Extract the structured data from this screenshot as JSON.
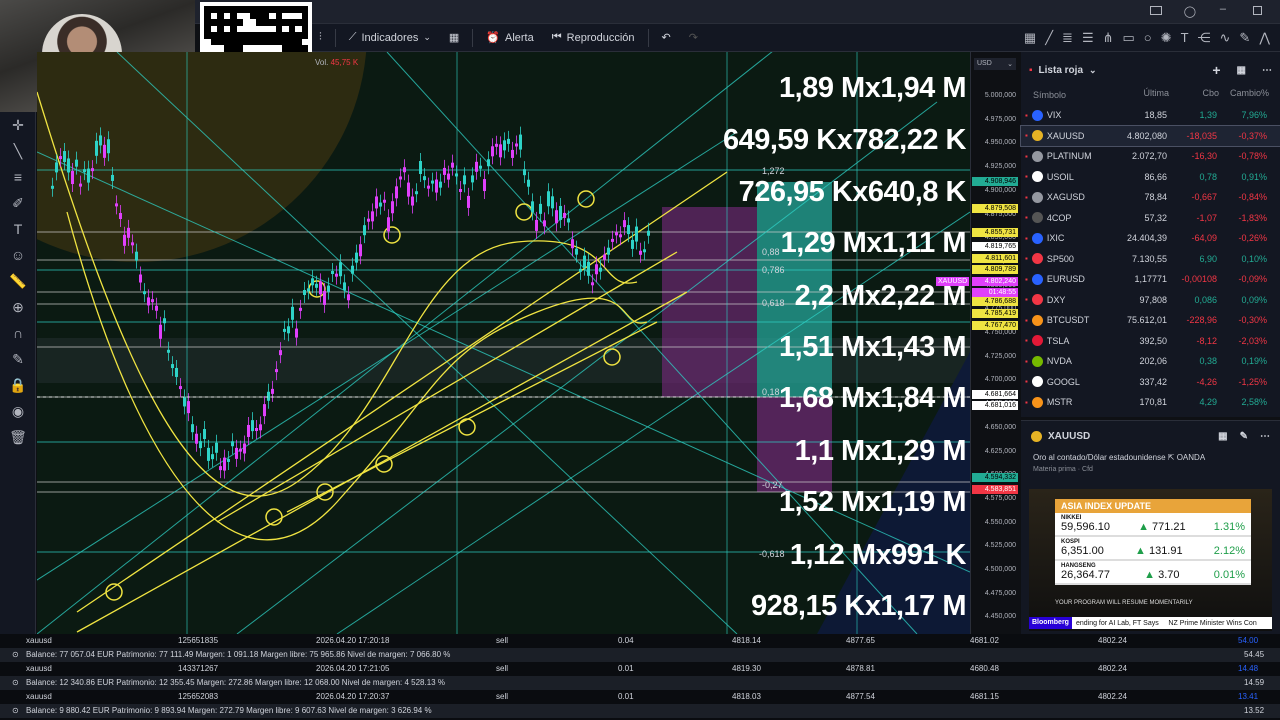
{
  "toolbar": {
    "indicators_label": "Indicadores",
    "alert_label": "Alerta",
    "replay_label": "Reproducción"
  },
  "chart": {
    "volume_label": "Vol.",
    "volume_value": "45,75 K",
    "currency": "USD",
    "overlay_labels": [
      "1,89 Mx1,94 M",
      "649,59 Kx782,22 K",
      "726,95 Kx640,8 K",
      "1,29 Mx1,11 M",
      "2,2 Mx2,22 M",
      "1,51 Mx1,43 M",
      "1,68 Mx1,84 M",
      "1,1 Mx1,29 M",
      "1,52 Mx1,19 M",
      "1,12 Mx991 K",
      "928,15 Kx1,17 M"
    ],
    "fib_levels": [
      "1,272",
      "0,88",
      "0,786",
      "0,618",
      "0,18",
      "-0,27",
      "-0,618"
    ],
    "price_ticks": [
      "5.000,000",
      "4.975,000",
      "4.950,000",
      "4.925,000",
      "4.900,000",
      "4.875,000",
      "4.850,000",
      "4.825,000",
      "4.800,000",
      "4.775,000",
      "4.750,000",
      "4.725,000",
      "4.700,000",
      "4.675,000",
      "4.650,000",
      "4.625,000",
      "4.600,000",
      "4.575,000",
      "4.550,000",
      "4.525,000",
      "4.500,000",
      "4.475,000",
      "4.450,000"
    ],
    "price_tags": [
      {
        "text": "4.908,946",
        "color": "#22ab94"
      },
      {
        "text": "4.879,508",
        "color": "#f0e442"
      },
      {
        "text": "4.855,731",
        "color": "#f0e442"
      },
      {
        "text": "4.819,765",
        "color": "#ffffff"
      },
      {
        "text": "4.811,601",
        "color": "#f0e442"
      },
      {
        "text": "4.809,789",
        "color": "#f0e442"
      },
      {
        "text": "4.802,240",
        "color": "#e040fb"
      },
      {
        "text": "01:48:55",
        "color": "#e040fb"
      },
      {
        "text": "4.786,688",
        "color": "#f0e442"
      },
      {
        "text": "4.785,419",
        "color": "#f0e442"
      },
      {
        "text": "4.767,470",
        "color": "#f0e442"
      },
      {
        "text": "4.681,664",
        "color": "#ffffff"
      },
      {
        "text": "4.681,016",
        "color": "#ffffff"
      },
      {
        "text": "4.594,332",
        "color": "#22ab94"
      },
      {
        "text": "4.583,851",
        "color": "#f23645"
      }
    ],
    "symbol_tag": "XAUUSD"
  },
  "watchlist": {
    "title": "Lista roja",
    "columns": [
      "Símbolo",
      "Última",
      "Cbo",
      "Cambio%"
    ],
    "rows": [
      {
        "sym": "VIX",
        "last": "18,85",
        "chg": "1,39",
        "pct": "7,96%",
        "up": true,
        "color": "#2962ff"
      },
      {
        "sym": "XAUUSD",
        "last": "4.802,080",
        "chg": "-18,035",
        "pct": "-0,37%",
        "up": false,
        "color": "#e6b325"
      },
      {
        "sym": "PLATINUM",
        "last": "2.072,70",
        "chg": "-16,30",
        "pct": "-0,78%",
        "up": false,
        "color": "#9598a1"
      },
      {
        "sym": "USOIL",
        "last": "86,66",
        "chg": "0,78",
        "pct": "0,91%",
        "up": true,
        "color": "#ffffff"
      },
      {
        "sym": "XAGUSD",
        "last": "78,84",
        "chg": "-0,667",
        "pct": "-0,84%",
        "up": false,
        "color": "#9598a1"
      },
      {
        "sym": "4COP",
        "last": "57,32",
        "chg": "-1,07",
        "pct": "-1,83%",
        "up": false,
        "color": "#555"
      },
      {
        "sym": "IXIC",
        "last": "24.404,39",
        "chg": "-64,09",
        "pct": "-0,26%",
        "up": false,
        "color": "#2962ff"
      },
      {
        "sym": "SP500",
        "last": "7.130,55",
        "chg": "6,90",
        "pct": "0,10%",
        "up": true,
        "color": "#f23645"
      },
      {
        "sym": "EURUSD",
        "last": "1,17771",
        "chg": "-0,00108",
        "pct": "-0,09%",
        "up": false,
        "color": "#2962ff"
      },
      {
        "sym": "DXY",
        "last": "97,808",
        "chg": "0,086",
        "pct": "0,09%",
        "up": true,
        "color": "#f23645"
      },
      {
        "sym": "BTCUSDT",
        "last": "75.612,01",
        "chg": "-228,96",
        "pct": "-0,30%",
        "up": false,
        "color": "#f7931a"
      },
      {
        "sym": "TSLA",
        "last": "392,50",
        "chg": "-8,12",
        "pct": "-2,03%",
        "up": false,
        "color": "#e31937"
      },
      {
        "sym": "NVDA",
        "last": "202,06",
        "chg": "0,38",
        "pct": "0,19%",
        "up": true,
        "color": "#76b900"
      },
      {
        "sym": "GOOGL",
        "last": "337,42",
        "chg": "-4,26",
        "pct": "-1,25%",
        "up": false,
        "color": "#ffffff"
      },
      {
        "sym": "MSTR",
        "last": "170,81",
        "chg": "4,29",
        "pct": "2,58%",
        "up": true,
        "color": "#f7931a"
      }
    ]
  },
  "detail": {
    "symbol": "XAUUSD",
    "description": "Oro al contado/Dólar estadounidense",
    "broker": "OANDA",
    "category": "Materia prima",
    "type": "Cfd"
  },
  "bloomberg": {
    "title": "ASIA INDEX UPDATE",
    "rows": [
      {
        "name": "NIKKEI",
        "value": "59,596.10",
        "chg": "771.21",
        "pct": "1.31%"
      },
      {
        "name": "KOSPI",
        "value": "6,351.00",
        "chg": "131.91",
        "pct": "2.12%"
      },
      {
        "name": "HANGSENG",
        "value": "26,364.77",
        "chg": "3.70",
        "pct": "0.01%"
      }
    ],
    "notice": "YOUR PROGRAM WILL RESUME MOMENTARILY",
    "brand": "Bloomberg",
    "ticker": "ending for AI Lab, FT Says     NZ Prime Minister Wins Con"
  },
  "positions": [
    {
      "symbol": "xauusd",
      "id": "125651835",
      "time": "2026.04.20 17:20:18",
      "side": "sell",
      "vol": "0.04",
      "open": "4818.14",
      "sl": "4877.65",
      "tp": "4681.02",
      "cur": "4802.24",
      "profit": "54.00"
    },
    {
      "symbol": "xauusd",
      "id": "143371267",
      "time": "2026.04.20 17:21:05",
      "side": "sell",
      "vol": "0.01",
      "open": "4819.30",
      "sl": "4878.81",
      "tp": "4680.48",
      "cur": "4802.24",
      "profit": "14.48"
    },
    {
      "symbol": "xauusd",
      "id": "125652083",
      "time": "2026.04.20 17:20:37",
      "side": "sell",
      "vol": "0.01",
      "open": "4818.03",
      "sl": "4877.54",
      "tp": "4681.15",
      "cur": "4802.24",
      "profit": "13.41"
    }
  ],
  "balances": [
    {
      "text": "Balance: 77 057.04 EUR  Patrimonio: 77 111.49  Margen: 1 091.18  Margen libre: 75 965.86  Nivel de margen: 7 066.80 %",
      "total": "54.45"
    },
    {
      "text": "Balance: 12 340.86 EUR  Patrimonio: 12 355.45  Margen: 272.86  Margen libre: 12 068.00  Nivel de margen: 4 528.13 %",
      "total": "14.59"
    },
    {
      "text": "Balance: 9 880.42 EUR  Patrimonio: 9 893.94  Margen: 272.79  Margen libre: 9 607.63  Nivel de margen: 3 626.94 %",
      "total": "13.52"
    }
  ]
}
